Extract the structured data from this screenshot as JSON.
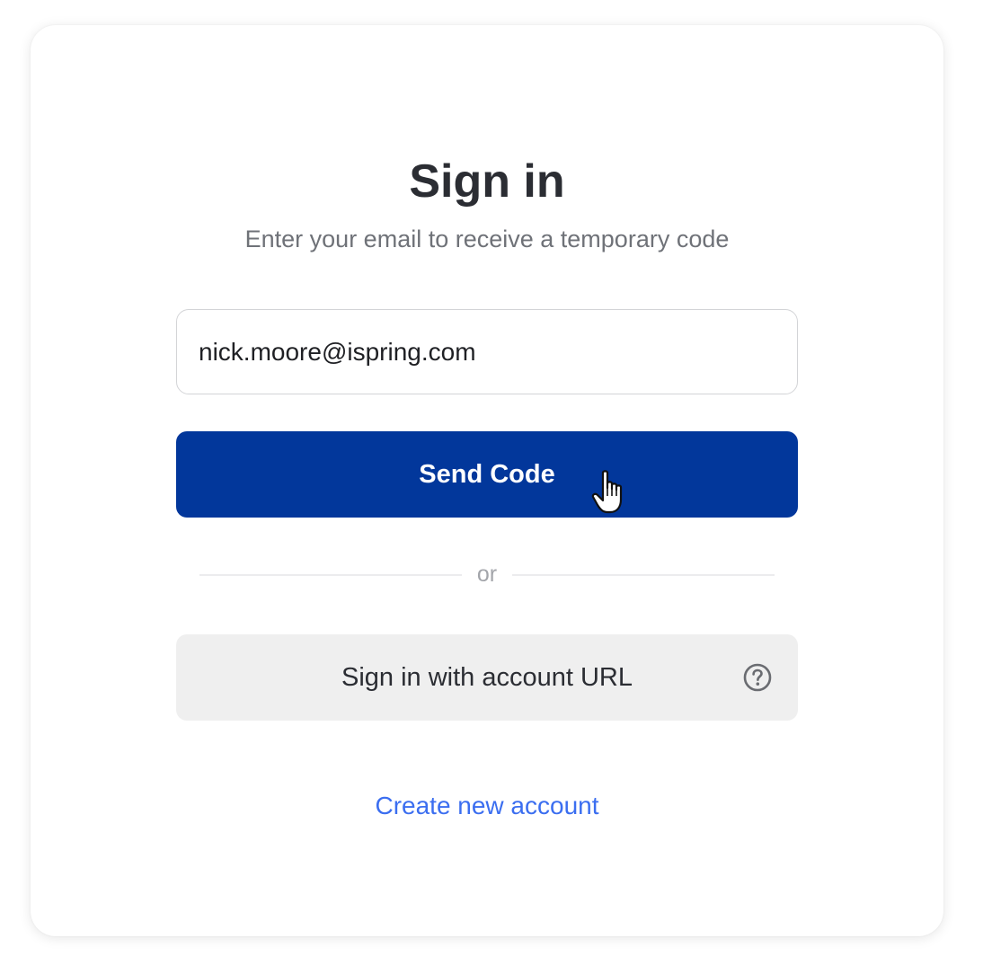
{
  "signin": {
    "title": "Sign in",
    "subtitle": "Enter your email to receive a temporary code",
    "email_value": "nick.moore@ispring.com",
    "send_code_label": "Send Code",
    "divider_label": "or",
    "account_url_label": "Sign in with account URL",
    "help_icon": "question-circle-icon",
    "create_account_label": "Create new account"
  },
  "colors": {
    "primary": "#02379b",
    "link": "#3b6ef0",
    "secondary_button": "#efefef",
    "title": "#2b2d33",
    "subtitle": "#6f7278"
  }
}
